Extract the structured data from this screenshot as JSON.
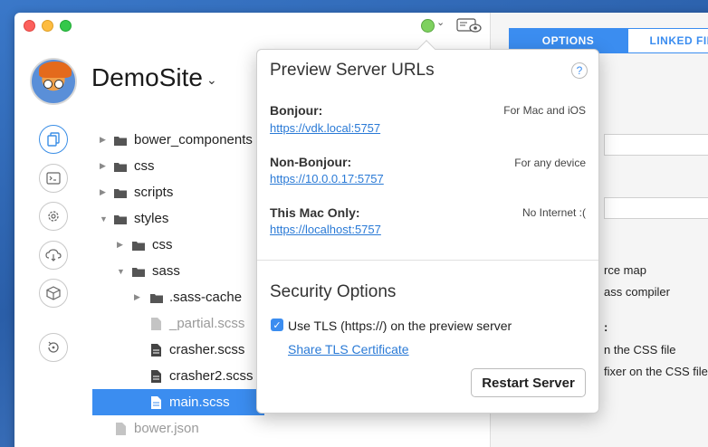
{
  "app": {
    "site_name": "DemoSite"
  },
  "colors": {
    "accent": "#3b8df0",
    "status_green": "#7ed15f",
    "link": "#2a7ad6"
  },
  "toolbar": {
    "status_icon": "server-status-icon",
    "preview_icon": "eye-preview-icon"
  },
  "sidebar_icons": [
    "files-icon",
    "terminal-icon",
    "gear-icon",
    "cloud-icon",
    "package-icon",
    "refresh-icon"
  ],
  "file_tree": [
    {
      "label": "bower_components",
      "type": "folder"
    },
    {
      "label": "css",
      "type": "folder"
    },
    {
      "label": "scripts",
      "type": "folder"
    },
    {
      "label": "styles",
      "type": "folder",
      "expanded": true
    },
    {
      "label": "css",
      "type": "folder"
    },
    {
      "label": "sass",
      "type": "folder",
      "expanded": true
    },
    {
      "label": ".sass-cache",
      "type": "folder"
    },
    {
      "label": "_partial.scss",
      "type": "file",
      "dim": true
    },
    {
      "label": "crasher.scss",
      "type": "file"
    },
    {
      "label": "crasher2.scss",
      "type": "file"
    },
    {
      "label": "main.scss",
      "type": "file",
      "selected": true
    },
    {
      "label": "bower.json",
      "type": "file",
      "dim": true
    }
  ],
  "right_pane": {
    "tab_options": "OPTIONS",
    "tab_linked": "LINKED FIL",
    "partial_lines": [
      "rce map",
      "ass compiler",
      ":",
      "n the CSS file",
      "fixer on the CSS file"
    ]
  },
  "popover": {
    "title": "Preview Server URLs",
    "help": "?",
    "servers": [
      {
        "name": "Bonjour:",
        "desc": "For Mac and iOS",
        "url": "https://vdk.local:5757"
      },
      {
        "name": "Non-Bonjour:",
        "desc": "For any device",
        "url": "https://10.0.0.17:5757"
      },
      {
        "name": "This Mac Only:",
        "desc": "No Internet :(",
        "url": "https://localhost:5757"
      }
    ],
    "security_title": "Security Options",
    "tls_label": "Use TLS (https://) on the preview server",
    "tls_checked": true,
    "share_link": "Share TLS Certificate",
    "restart_button": "Restart Server"
  }
}
